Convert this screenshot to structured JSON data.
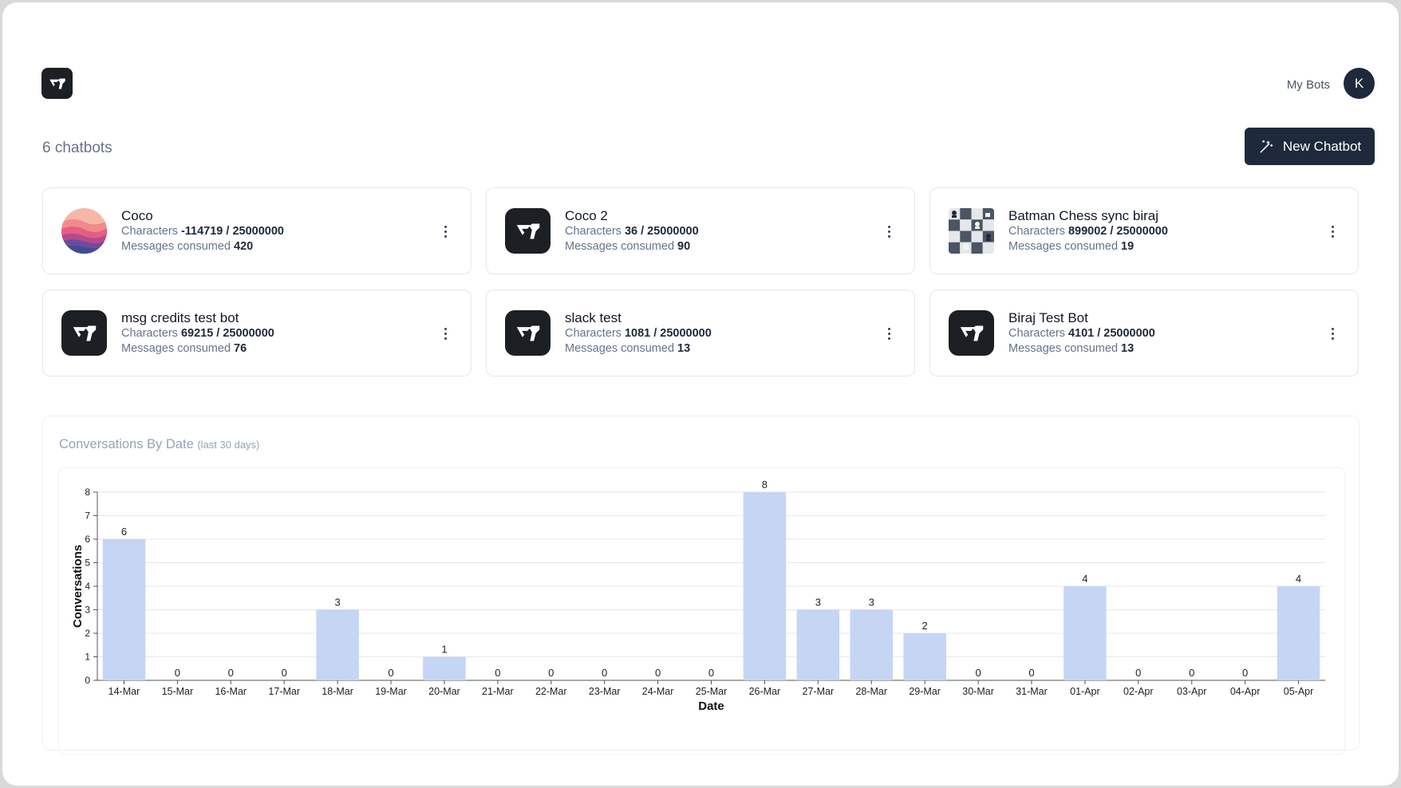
{
  "header": {
    "nav_link": "My Bots",
    "avatar_initial": "K"
  },
  "toolbar": {
    "count_label": "6 chatbots",
    "new_button_label": "New Chatbot"
  },
  "labels": {
    "characters": "Characters",
    "messages": "Messages consumed"
  },
  "bots": [
    {
      "name": "Coco",
      "avatar": "sunset-avatar",
      "characters": "-114719 / 25000000",
      "messages": "420"
    },
    {
      "name": "Coco 2",
      "avatar": "logo-avatar",
      "characters": "36 / 25000000",
      "messages": "90"
    },
    {
      "name": "Batman Chess sync biraj",
      "avatar": "chess-avatar",
      "characters": "899002 / 25000000",
      "messages": "19"
    },
    {
      "name": "msg credits test bot",
      "avatar": "logo-avatar",
      "characters": "69215 / 25000000",
      "messages": "76"
    },
    {
      "name": "slack test",
      "avatar": "logo-avatar",
      "characters": "1081 / 25000000",
      "messages": "13"
    },
    {
      "name": "Biraj Test Bot",
      "avatar": "logo-avatar",
      "characters": "4101 / 25000000",
      "messages": "13"
    }
  ],
  "chart_panel": {
    "title": "Conversations By Date",
    "subtitle": "(last 30 days)"
  },
  "colors": {
    "bar": "#c5d6f4",
    "primary": "#1e293b",
    "grid": "#e4e7eb"
  },
  "chart_data": {
    "type": "bar",
    "categories": [
      "14-Mar",
      "15-Mar",
      "16-Mar",
      "17-Mar",
      "18-Mar",
      "19-Mar",
      "20-Mar",
      "21-Mar",
      "22-Mar",
      "23-Mar",
      "24-Mar",
      "25-Mar",
      "26-Mar",
      "27-Mar",
      "28-Mar",
      "29-Mar",
      "30-Mar",
      "31-Mar",
      "01-Apr",
      "02-Apr",
      "03-Apr",
      "04-Apr",
      "05-Apr"
    ],
    "values": [
      6,
      0,
      0,
      0,
      3,
      0,
      1,
      0,
      0,
      0,
      0,
      0,
      8,
      3,
      3,
      2,
      0,
      0,
      4,
      0,
      0,
      0,
      4
    ],
    "xlabel": "Date",
    "ylabel": "Conversations",
    "ylim": [
      0,
      8
    ],
    "yticks": [
      0,
      1,
      2,
      3,
      4,
      5,
      6,
      7,
      8
    ],
    "grid": true,
    "data_labels": true
  }
}
